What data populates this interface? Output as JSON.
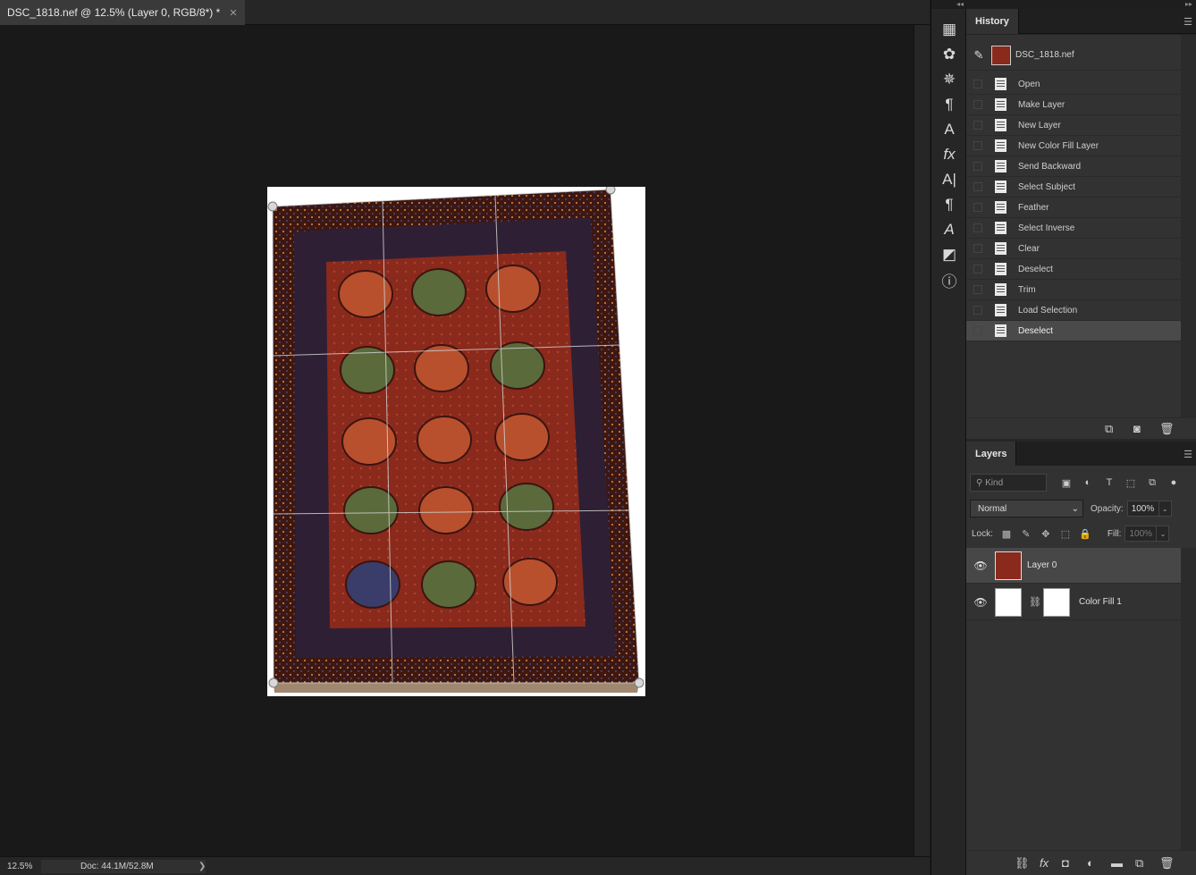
{
  "document": {
    "tab_title": "DSC_1818.nef @ 12.5% (Layer 0, RGB/8*) *",
    "close_glyph": "✕"
  },
  "statusbar": {
    "zoom": "12.5%",
    "doc_info": "Doc: 44.1M/52.8M",
    "arrow": "❯"
  },
  "toolbar_icons": [
    "grid-icon",
    "palette-icon",
    "compass-icon",
    "character-paragraph-icon",
    "glyph-style-icon",
    "fx-icon",
    "text-icon",
    "paragraph-icon",
    "glyphs-icon",
    "3d-icon",
    "info-icon"
  ],
  "history": {
    "tab_label": "History",
    "snapshot_name": "DSC_1818.nef",
    "items": [
      {
        "label": "Open"
      },
      {
        "label": "Make Layer"
      },
      {
        "label": "New Layer"
      },
      {
        "label": "New Color Fill Layer"
      },
      {
        "label": "Send Backward"
      },
      {
        "label": "Select Subject"
      },
      {
        "label": "Feather"
      },
      {
        "label": "Select Inverse"
      },
      {
        "label": "Clear"
      },
      {
        "label": "Deselect"
      },
      {
        "label": "Trim"
      },
      {
        "label": "Load Selection"
      },
      {
        "label": "Deselect"
      }
    ],
    "active_index": 12
  },
  "layers": {
    "tab_label": "Layers",
    "kind_placeholder": "Kind",
    "blend_mode": "Normal",
    "opacity_label": "Opacity:",
    "opacity_value": "100%",
    "lock_label": "Lock:",
    "fill_label": "Fill:",
    "fill_value": "100%",
    "items": [
      {
        "name": "Layer 0",
        "active": true
      },
      {
        "name": "Color Fill 1",
        "active": false
      }
    ]
  },
  "colors": {
    "rug_red": "#8a2a1c",
    "rug_dark": "#3b1410",
    "rug_navy": "#2a2540"
  }
}
